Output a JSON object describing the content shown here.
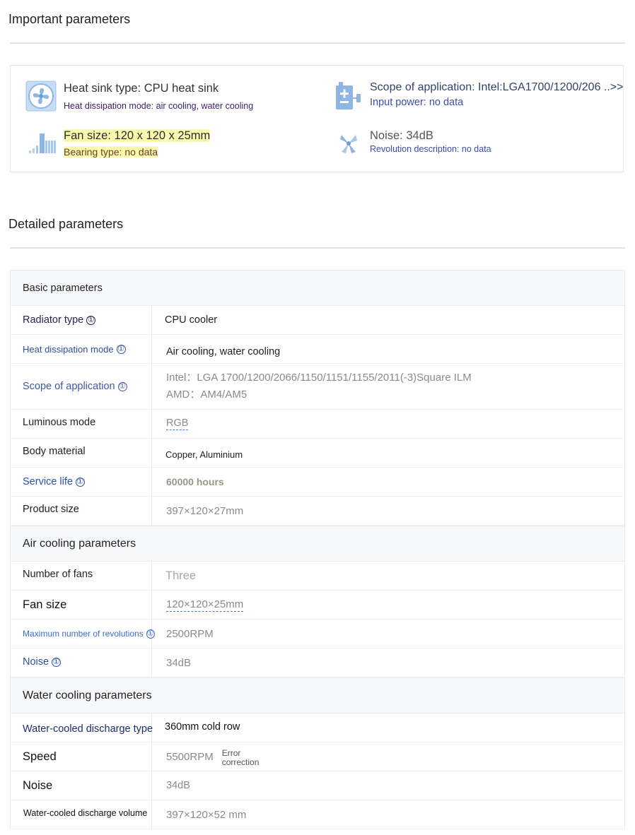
{
  "important": {
    "title": "Important parameters",
    "items": [
      {
        "main": "Heat sink type: CPU heat sink",
        "sub": "Heat dissipation mode: air cooling, water cooling",
        "icon": "fan-icon"
      },
      {
        "main": "Scope of application: Intel:LGA1700/1200/206 ..>>",
        "sub": "Input power: no data",
        "icon": "power-plug-icon"
      },
      {
        "main": "Fan size: 120 x 120 x 25mm",
        "sub": "Bearing type: no data",
        "icon": "bars-size-icon"
      },
      {
        "main": "Noise: 34dB",
        "sub": "Revolution description: no data",
        "icon": "propeller-icon"
      }
    ]
  },
  "detailed": {
    "title": "Detailed parameters",
    "info_glyph": "①",
    "groups": [
      {
        "name": "Basic parameters",
        "rows": [
          {
            "key": "Radiator type",
            "value": "CPU cooler"
          },
          {
            "key": "Heat dissipation mode",
            "value": "Air cooling, water cooling"
          },
          {
            "key": "Scope of application",
            "value_lines": [
              "Intel：LGA 1700/1200/2066/1150/1151/1155/2011(-3)Square ILM",
              "AMD：AM4/AM5"
            ]
          },
          {
            "key": "Luminous mode",
            "value": "RGB"
          },
          {
            "key": "Body material",
            "value": "Copper, Aluminium"
          },
          {
            "key": "Service life",
            "value": "60000 hours"
          },
          {
            "key": "Product size",
            "value": "397×120×27mm"
          }
        ]
      },
      {
        "name": "Air cooling parameters",
        "rows": [
          {
            "key": "Number of fans",
            "value": "Three"
          },
          {
            "key": "Fan size",
            "value": "120×120×25mm"
          },
          {
            "key": "Maximum number of revolutions",
            "value": "2500RPM"
          },
          {
            "key": "Noise",
            "value": "34dB"
          }
        ]
      },
      {
        "name": "Water cooling parameters",
        "rows": [
          {
            "key": "Water-cooled discharge type",
            "value": "360mm cold row"
          },
          {
            "key": "Speed",
            "value": "5500RPM",
            "note_lines": [
              "Error",
              "correction"
            ]
          },
          {
            "key": "Noise",
            "value": "34dB"
          },
          {
            "key": "Water-cooled discharge volume",
            "value": "397×120×52 mm"
          }
        ]
      }
    ]
  }
}
